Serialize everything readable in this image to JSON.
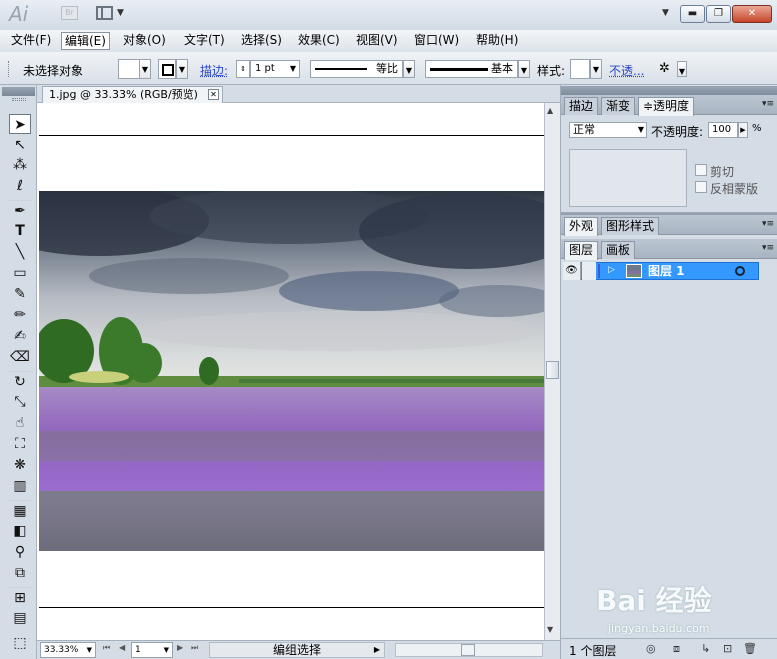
{
  "app": {
    "logo": "Ai",
    "bridge_label": "Br"
  },
  "window_buttons": {
    "minimize": "▬",
    "restore": "❐",
    "close": "✕"
  },
  "menu": [
    {
      "label": "文件(F)"
    },
    {
      "label": "编辑(E)"
    },
    {
      "label": "对象(O)"
    },
    {
      "label": "文字(T)"
    },
    {
      "label": "选择(S)"
    },
    {
      "label": "效果(C)"
    },
    {
      "label": "视图(V)"
    },
    {
      "label": "窗口(W)"
    },
    {
      "label": "帮助(H)"
    }
  ],
  "control": {
    "selection_status": "未选择对象",
    "stroke_label": "描边:",
    "stroke_weight": "1 pt",
    "profile_label": "等比",
    "brush_label": "基本",
    "style_label": "样式:",
    "opacity_link": "不透..."
  },
  "document": {
    "tab_title": "1.jpg @ 33.33% (RGB/预览)",
    "close": "✕"
  },
  "status": {
    "zoom": "33.33%",
    "page": "1",
    "tool_status": "编组选择"
  },
  "panels": {
    "top_tabs": [
      {
        "label": "描边"
      },
      {
        "label": "渐变"
      },
      {
        "label": "≑透明度"
      }
    ],
    "blend_mode": "正常",
    "opacity_label": "不透明度:",
    "opacity_value": "100",
    "opacity_unit": "%",
    "clip_label": "剪切",
    "invert_mask_label": "反相蒙版",
    "mid_tabs": [
      {
        "label": "外观"
      },
      {
        "label": "图形样式"
      }
    ],
    "layer_tabs": [
      {
        "label": "图层"
      },
      {
        "label": "画板"
      }
    ],
    "layers": [
      {
        "name": "图层 1"
      }
    ],
    "layer_count": "1 个图层"
  },
  "watermark": {
    "main": "Bai  经验",
    "sub": "jingyan.baidu.com"
  },
  "icons": [
    "selection-tool-icon",
    "direct-selection-icon",
    "magic-wand-icon",
    "lasso-icon",
    "pen-icon",
    "type-icon",
    "line-icon",
    "rectangle-icon",
    "paintbrush-icon",
    "pencil-icon",
    "blob-brush-icon",
    "eraser-icon",
    "rotate-icon",
    "scale-icon",
    "warp-icon",
    "free-transform-icon",
    "symbol-sprayer-icon",
    "column-graph-icon",
    "mesh-icon",
    "gradient-icon",
    "eyedropper-icon",
    "blend-icon",
    "slice-icon",
    "hand-icon",
    "artboard-icon"
  ]
}
